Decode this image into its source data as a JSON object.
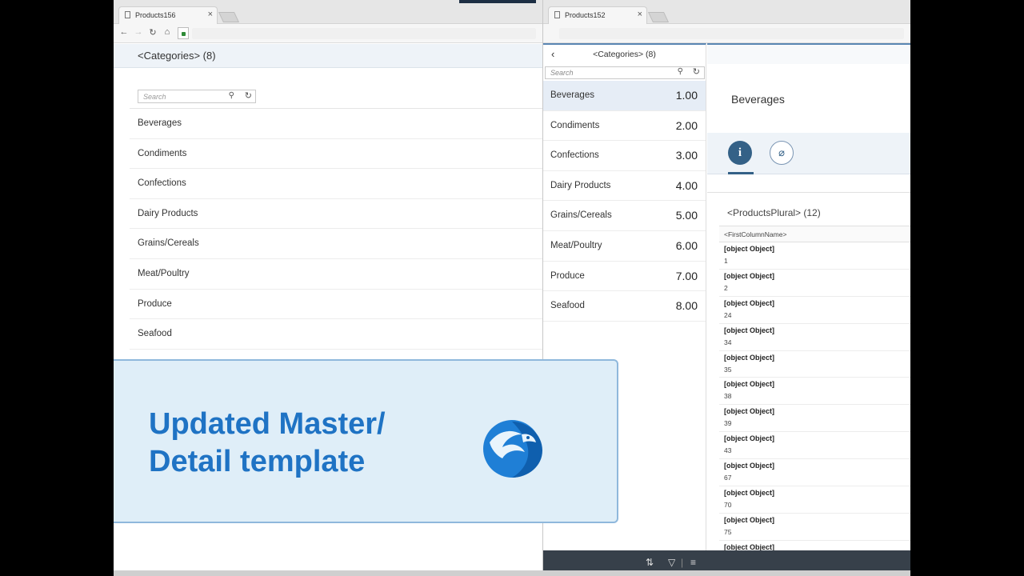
{
  "left_window": {
    "tab_title": "Products156",
    "list_header": "<Categories> (8)",
    "search_placeholder": "Search",
    "items": [
      "Beverages",
      "Condiments",
      "Confections",
      "Dairy Products",
      "Grains/Cereals",
      "Meat/Poultry",
      "Produce",
      "Seafood"
    ]
  },
  "right_window": {
    "tab_title": "Products152",
    "master": {
      "header": "<Categories> (8)",
      "search_placeholder": "Search",
      "items": [
        {
          "label": "Beverages",
          "value": "1.00"
        },
        {
          "label": "Condiments",
          "value": "2.00"
        },
        {
          "label": "Confections",
          "value": "3.00"
        },
        {
          "label": "Dairy Products",
          "value": "4.00"
        },
        {
          "label": "Grains/Cereals",
          "value": "5.00"
        },
        {
          "label": "Meat/Poultry",
          "value": "6.00"
        },
        {
          "label": "Produce",
          "value": "7.00"
        },
        {
          "label": "Seafood",
          "value": "8.00"
        }
      ],
      "selected_index": 0
    },
    "detail": {
      "title": "Beverages",
      "tabs": [
        {
          "icon": "info-icon"
        },
        {
          "icon": "paperclip-icon"
        }
      ],
      "products_title": "<ProductsPlural> (12)",
      "column_header": "<FirstColumnName>",
      "rows": [
        {
          "title": "[object Object]",
          "id": "1"
        },
        {
          "title": "[object Object]",
          "id": "2"
        },
        {
          "title": "[object Object]",
          "id": "24"
        },
        {
          "title": "[object Object]",
          "id": "34"
        },
        {
          "title": "[object Object]",
          "id": "35"
        },
        {
          "title": "[object Object]",
          "id": "38"
        },
        {
          "title": "[object Object]",
          "id": "39"
        },
        {
          "title": "[object Object]",
          "id": "43"
        },
        {
          "title": "[object Object]",
          "id": "67"
        },
        {
          "title": "[object Object]",
          "id": "70"
        },
        {
          "title": "[object Object]",
          "id": "75"
        },
        {
          "title": "[object Object]",
          "id": ""
        }
      ]
    },
    "footer_icons": [
      "sort-icon",
      "filter-icon",
      "group-icon"
    ]
  },
  "banner": {
    "text": "Updated Master/\nDetail template",
    "color": "#1f73c4"
  }
}
